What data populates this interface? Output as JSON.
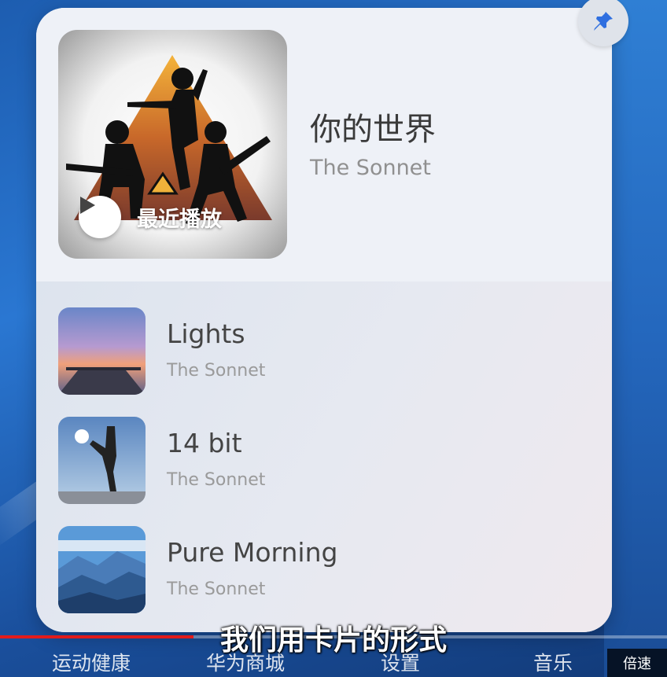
{
  "widget": {
    "now_playing": {
      "title": "你的世界",
      "artist": "The Sonnet",
      "recent_label": "最近播放"
    },
    "tracks": [
      {
        "title": "Lights",
        "artist": "The Sonnet"
      },
      {
        "title": "14 bit",
        "artist": "The Sonnet"
      },
      {
        "title": "Pure Morning",
        "artist": "The Sonnet"
      }
    ]
  },
  "dock": {
    "items": [
      "运动健康",
      "华为商城",
      "设置",
      "音乐"
    ]
  },
  "video": {
    "subtitle": "我们用卡片的形式",
    "speed_label": "倍速",
    "progress": 0.29
  },
  "colors": {
    "pin_accent": "#2f6fe0",
    "progress_red": "#e21b1b"
  }
}
